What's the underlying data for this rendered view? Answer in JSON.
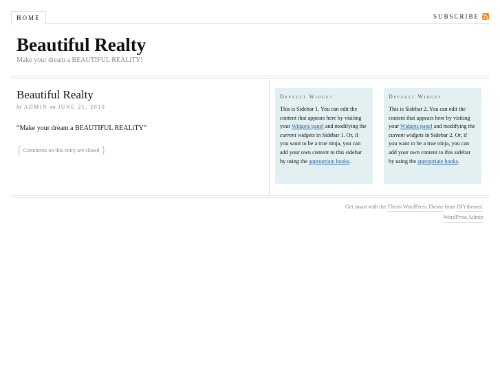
{
  "nav": {
    "home": "HOME",
    "subscribe": "SUBSCRIBE"
  },
  "header": {
    "title": "Beautiful Realty",
    "tagline": "Make your dream a BEAUTIFUL REALiTY!"
  },
  "post": {
    "title": "Beautiful Realty",
    "by": "by",
    "author": "ADMIN",
    "on": "on",
    "date": "JUNE 21, 2010",
    "quote": "“Make your dream a BEAUTIFUL REALiTY”",
    "comments": "Comments on this entry are closed"
  },
  "sidebar1": {
    "heading": "Default Widget",
    "t1": "This is Sidebar 1. You can edit the content that appears here by visiting your ",
    "link1": "Widgets panel",
    "t2": " and modifying the ",
    "em": "current widgets",
    "t3": " in Sidebar 1. Or, if you want to be a true ninja, you can add your own content to this sidebar by using the ",
    "link2": "appropriate hooks",
    "t4": "."
  },
  "sidebar2": {
    "heading": "Default Widget",
    "t1": "This is Sidebar 2. You can edit the content that appears here by visiting your ",
    "link1": "Widgets panel",
    "t2": " and modifying the ",
    "em": "current widgets",
    "t3": " in Sidebar 2. Or, if you want to be a true ninja, you can add your own content to this sidebar by using the ",
    "link2": "appropriate hooks",
    "t4": "."
  },
  "footer": {
    "pre": "Get smart with the ",
    "theme": "Thesis WordPress Theme",
    "mid": " from ",
    "diy": "DIYthemes",
    "end": ".",
    "admin": "WordPress Admin"
  }
}
